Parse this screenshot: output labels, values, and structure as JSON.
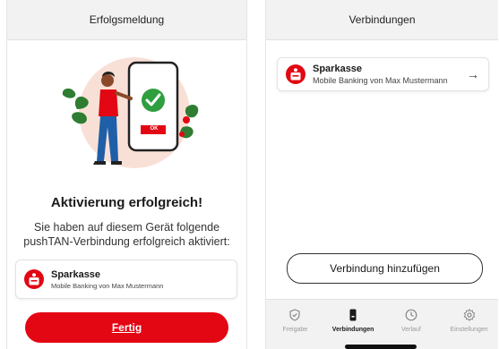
{
  "left": {
    "title": "Erfolgsmeldung",
    "ok_label": "OK",
    "heading": "Aktivierung erfolgreich!",
    "text": "Sie haben auf diesem Gerät folgende pushTAN-Verbindung erfolgreich aktiviert:",
    "card": {
      "title": "Sparkasse",
      "subtitle": "Mobile Banking von Max Mustermann"
    },
    "button": "Fertig"
  },
  "right": {
    "title": "Verbindungen",
    "card": {
      "title": "Sparkasse",
      "subtitle": "Mobile Banking von Max Mustermann",
      "arrow": "→"
    },
    "add_button": "Verbindung hinzufügen",
    "tabs": [
      {
        "label": "Freigabe",
        "icon": "shield-check-icon",
        "active": false
      },
      {
        "label": "Verbindungen",
        "icon": "phone-icon",
        "active": true
      },
      {
        "label": "Verlauf",
        "icon": "clock-icon",
        "active": false
      },
      {
        "label": "Einstellungen",
        "icon": "gear-icon",
        "active": false
      }
    ]
  },
  "colors": {
    "brand_red": "#e30613",
    "topbar_bg": "#f2f2f2",
    "success_green": "#2e9e3e"
  }
}
